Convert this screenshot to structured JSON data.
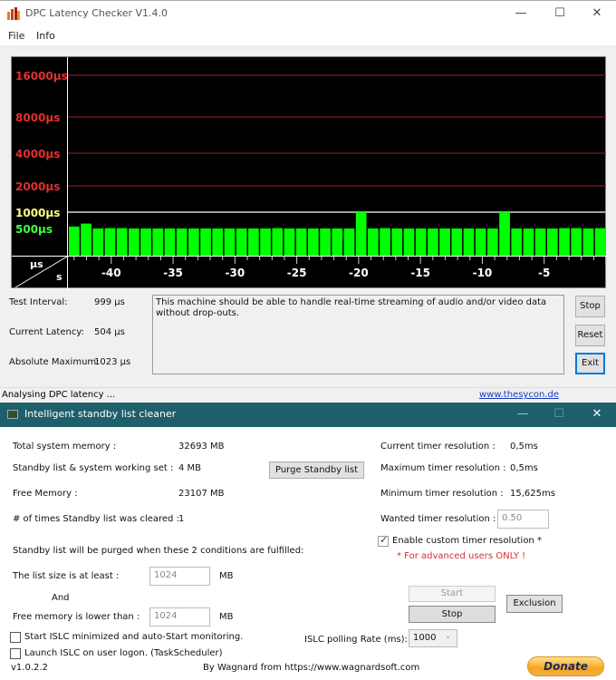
{
  "dpc_window": {
    "title": "DPC Latency Checker V1.4.0",
    "menu": [
      "File",
      "Info"
    ],
    "controls": {
      "minimize": "—",
      "maximize": "☐",
      "close": "✕"
    },
    "stats": [
      {
        "label": "Test Interval:",
        "value": "999 µs"
      },
      {
        "label": "Current Latency:",
        "value": "504 µs"
      },
      {
        "label": "Absolute Maximum:",
        "value": "1023 µs"
      }
    ],
    "message": "This machine should be able to handle real-time streaming of audio and/or video data without drop-outs.",
    "buttons": {
      "stop": "Stop",
      "reset": "Reset",
      "exit": "Exit"
    },
    "status": "Analysing DPC latency ...",
    "link": "www.thesycon.de"
  },
  "chart_data": {
    "type": "bar",
    "title": "",
    "xlabel": "s",
    "ylabel": "µs",
    "y_ticks": [
      {
        "label": "16000µs",
        "value": 16000,
        "color": "#e03030"
      },
      {
        "label": "8000µs",
        "value": 8000,
        "color": "#e03030"
      },
      {
        "label": "4000µs",
        "value": 4000,
        "color": "#e03030"
      },
      {
        "label": "2000µs",
        "value": 2000,
        "color": "#e03030"
      },
      {
        "label": "1000µs",
        "value": 1000,
        "color": "#ffff80"
      },
      {
        "label": "500µs",
        "value": 500,
        "color": "#40ff40"
      }
    ],
    "x_ticks": [
      "-40",
      "-35",
      "-30",
      "-25",
      "-20",
      "-15",
      "-10",
      "-5"
    ],
    "xlim": [
      -43.5,
      0
    ],
    "bar_color": "#00ff00",
    "values": [
      560,
      650,
      500,
      510,
      510,
      500,
      500,
      500,
      500,
      500,
      500,
      500,
      500,
      500,
      500,
      500,
      500,
      510,
      500,
      500,
      500,
      500,
      500,
      500,
      1000,
      500,
      510,
      500,
      500,
      500,
      500,
      500,
      500,
      500,
      500,
      500,
      1000,
      500,
      500,
      500,
      500,
      510,
      510,
      500,
      510
    ]
  },
  "islc_window": {
    "title": "Intelligent standby list cleaner",
    "controls": {
      "minimize": "—",
      "maximize": "☐",
      "close": "✕"
    },
    "memory": [
      {
        "label": "Total system memory :",
        "value": "32693 MB"
      },
      {
        "label": "Standby list & system working set :",
        "value": "4 MB"
      },
      {
        "label": "Free Memory :",
        "value": "23107 MB"
      },
      {
        "label": "# of times Standby list was cleared :",
        "value": "1"
      }
    ],
    "purge_button": "Purge Standby list",
    "timer": [
      {
        "label": "Current timer resolution :",
        "value": "0,5ms"
      },
      {
        "label": "Maximum timer resolution :",
        "value": "0,5ms"
      },
      {
        "label": "Minimum timer resolution :",
        "value": "15,625ms"
      }
    ],
    "wanted_label": "Wanted timer resolution :",
    "wanted_value": "0.50",
    "enable_custom_label": "Enable custom timer resolution *",
    "enable_custom_checked": true,
    "advanced_note": "* For advanced users ONLY !",
    "conditions_heading": "Standby list will be purged when these 2 conditions are fulfilled:",
    "list_size_label": "The list size is at least :",
    "list_size_value": "1024",
    "and_label": "And",
    "free_mem_label": "Free memory is lower than :",
    "free_mem_value": "1024",
    "unit_mb": "MB",
    "start_button": "Start",
    "stop_button": "Stop",
    "exclusion_button": "Exclusion",
    "polling_label": "ISLC polling Rate (ms):",
    "polling_value": "1000",
    "chk_minimized": "Start ISLC minimized and auto-Start monitoring.",
    "chk_logon": "Launch ISLC on user logon. (TaskScheduler)",
    "version": "v1.0.2.2",
    "credit": "By Wagnard from https://www.wagnardsoft.com",
    "donate": "Donate"
  }
}
